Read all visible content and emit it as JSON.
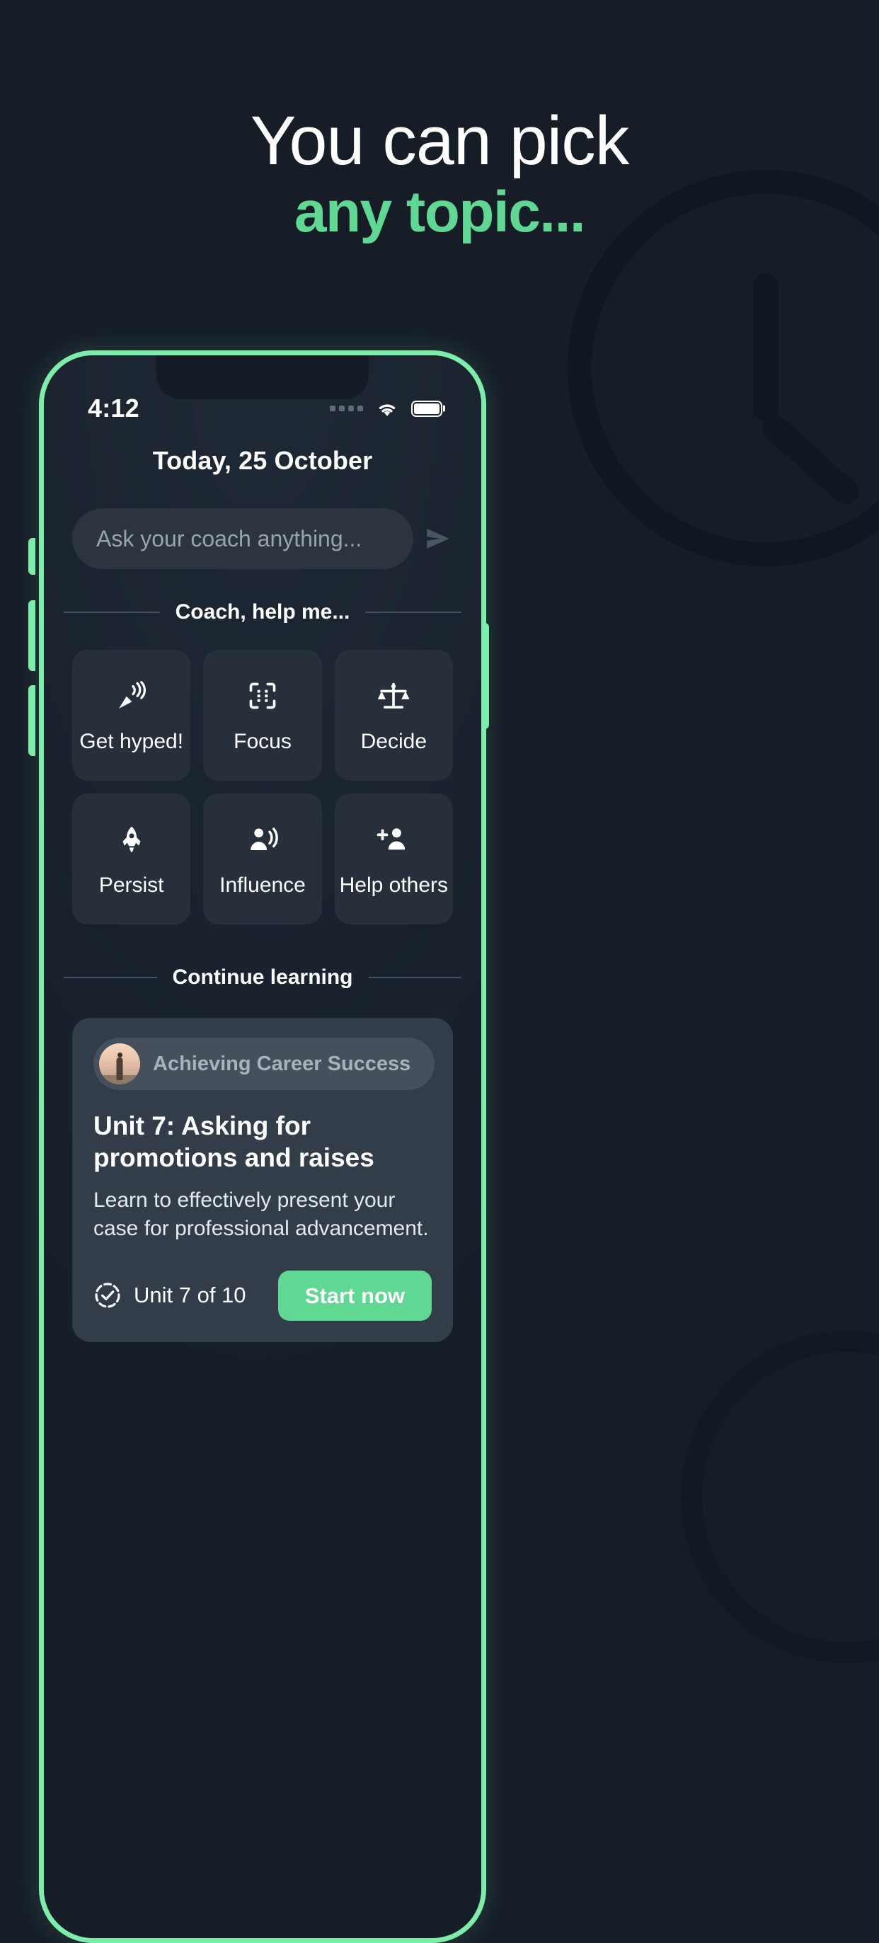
{
  "hero": {
    "line1": "You can pick",
    "line2": "any topic...",
    "accent_color": "#5fd894",
    "text_color": "#ffffff",
    "background_color": "#161d27"
  },
  "decor": {
    "clock_icon": "clock-icon"
  },
  "phone": {
    "frame_color": "#7dedaa",
    "status_bar": {
      "time": "4:12",
      "signal_icon": "signal-dots-icon",
      "wifi_icon": "wifi-icon",
      "battery_icon": "battery-full-icon"
    },
    "screen": {
      "date_title": "Today, 25 October",
      "search": {
        "placeholder": "Ask your coach anything...",
        "send_icon": "send-icon"
      },
      "quick_actions": {
        "section_label": "Coach, help me...",
        "items": [
          {
            "label": "Get hyped!",
            "icon": "party-popper-icon"
          },
          {
            "label": "Focus",
            "icon": "focus-scan-icon"
          },
          {
            "label": "Decide",
            "icon": "scales-icon"
          },
          {
            "label": "Persist",
            "icon": "rocket-icon"
          },
          {
            "label": "Influence",
            "icon": "person-speaking-icon"
          },
          {
            "label": "Help others",
            "icon": "add-person-icon"
          }
        ]
      },
      "continue_learning": {
        "section_label": "Continue learning",
        "card": {
          "course_chip": "Achieving Career Success",
          "avatar_icon": "course-avatar",
          "unit_title": "Unit 7: Asking for promotions and raises",
          "unit_description": "Learn to effectively present your case for professional advancement.",
          "progress_icon": "check-circle-dashed-icon",
          "progress_label": "Unit 7 of 10",
          "cta_label": "Start now",
          "cta_color": "#5fd894"
        }
      }
    }
  }
}
